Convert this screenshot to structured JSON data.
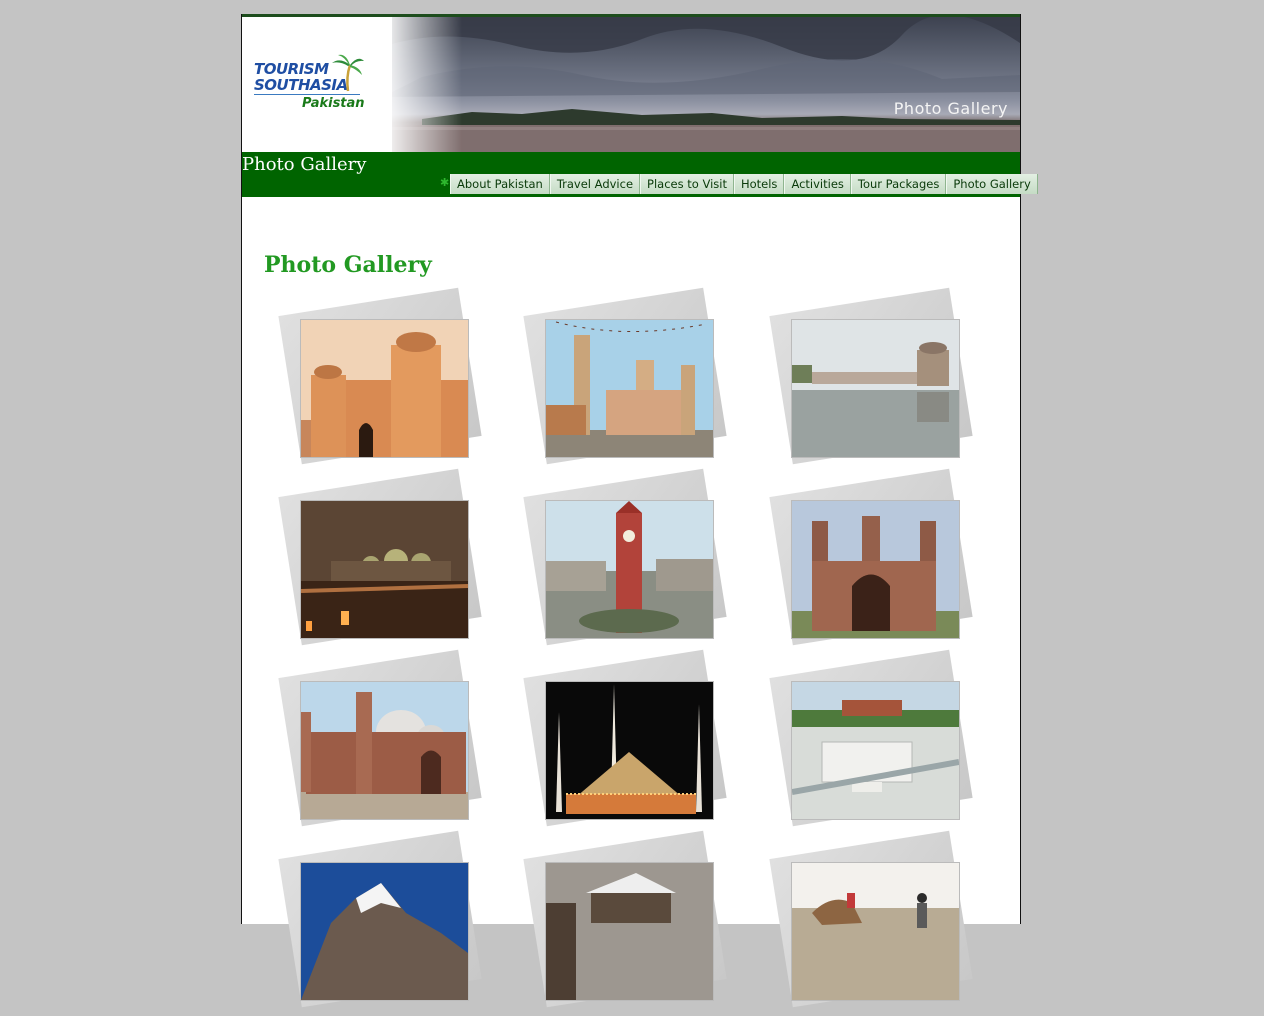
{
  "banner": {
    "logo": {
      "line1": "TOURISM",
      "line2": "SOUTHASIA",
      "line3": "Pakistan"
    },
    "caption": "Photo Gallery"
  },
  "greenbar": {
    "title": "Photo Gallery"
  },
  "nav": {
    "bullet": "✱",
    "items": [
      "About Pakistan",
      "Travel Advice",
      "Places to Visit",
      "Hotels",
      "Activities",
      "Tour Packages",
      "Photo Gallery"
    ]
  },
  "main": {
    "heading": "Photo Gallery"
  },
  "gallery": {
    "photos": [
      {
        "id": "fort",
        "icon": "fort-photo"
      },
      {
        "id": "mosque-minarets",
        "icon": "mosque-photo"
      },
      {
        "id": "water-palace",
        "icon": "water-palace-photo"
      },
      {
        "id": "night-mosque",
        "icon": "night-mosque-photo"
      },
      {
        "id": "clock-tower",
        "icon": "clock-tower-photo"
      },
      {
        "id": "chauburji",
        "icon": "chauburji-photo"
      },
      {
        "id": "badshahi-mosque",
        "icon": "badshahi-mosque-photo"
      },
      {
        "id": "faisal-mosque",
        "icon": "faisal-mosque-photo"
      },
      {
        "id": "marble-pavilion",
        "icon": "marble-pavilion-photo"
      },
      {
        "id": "mountain",
        "icon": "mountain-photo"
      },
      {
        "id": "snow-village",
        "icon": "snow-village-photo"
      },
      {
        "id": "camel-desert",
        "icon": "camel-photo"
      }
    ]
  },
  "colors": {
    "brand_green": "#006400",
    "heading_green": "#229922",
    "logo_blue": "#1f4ea3",
    "background": "#c4c4c4"
  }
}
